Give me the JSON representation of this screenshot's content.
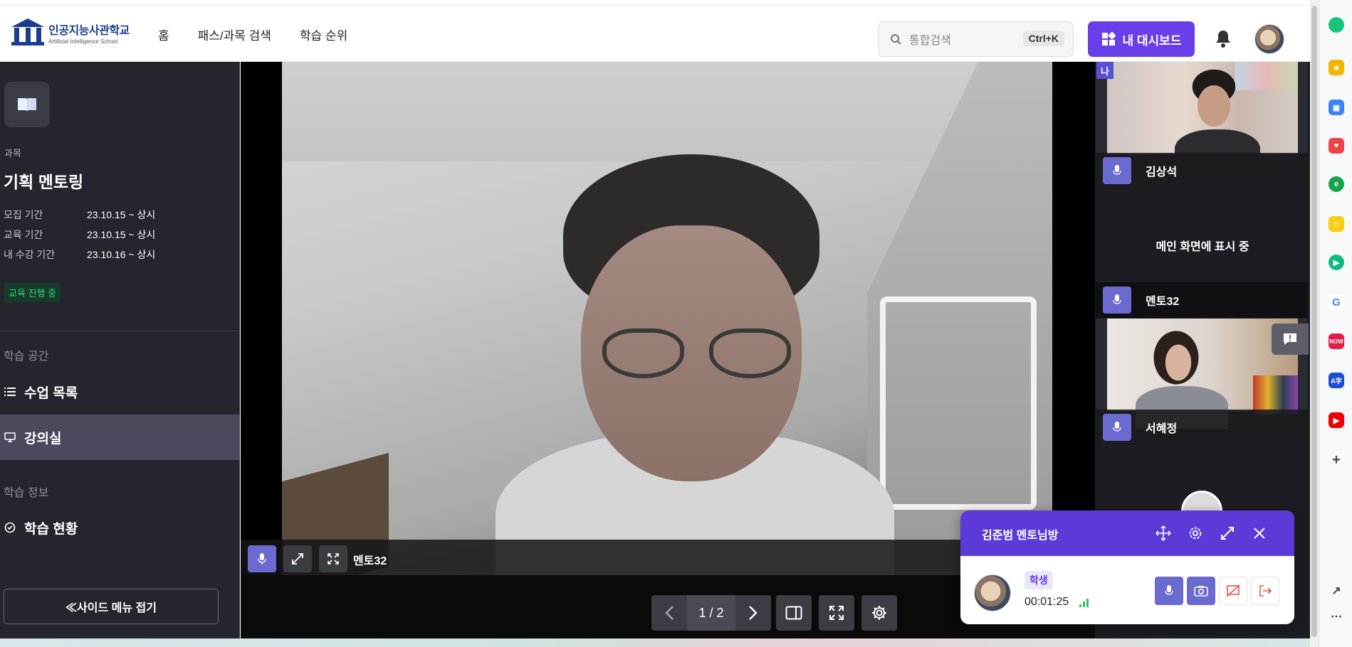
{
  "header": {
    "logo_ko": "인공지능사관학교",
    "logo_en": "Artificial Intelligence School",
    "nav": [
      "홈",
      "패스/과목 검색",
      "학습 순위"
    ],
    "search": {
      "placeholder": "통합검색",
      "shortcut": "Ctrl+K"
    },
    "dashboard_label": "내 대시보드"
  },
  "sidebar": {
    "category_label": "과목",
    "course_title": "기획 멘토링",
    "periods": [
      {
        "label": "모집 기간",
        "value": "23.10.15 ~ 상시"
      },
      {
        "label": "교육 기간",
        "value": "23.10.15 ~ 상시"
      },
      {
        "label": "내 수강 기간",
        "value": "23.10.16 ~ 상시"
      }
    ],
    "status": "교육 진행 중",
    "space_label": "학습 공간",
    "menu_class_list": "수업 목록",
    "menu_classroom": "강의실",
    "info_label": "학습 정보",
    "menu_progress": "학습 현황",
    "collapse_label": "≪사이드 메뉴 접기"
  },
  "stage": {
    "speaker_name": "멘토32",
    "pager": "1 / 2"
  },
  "participants": {
    "me_tag": "나",
    "p1_name": "김상석",
    "main_note": "메인 화면에 표시 중",
    "p2_name": "멘토32",
    "p3_name": "서혜정"
  },
  "room": {
    "title": "김준범 멘토님방",
    "role": "학생",
    "elapsed": "00:01:25"
  },
  "colors": {
    "accent": "#6a3ee8",
    "room_header": "#5b3ad8",
    "sidebar_bg": "#25252e",
    "mic_button": "#6b6ad0",
    "status_green": "#2ed37a"
  },
  "icons": [
    "search-icon",
    "dashboard-icon",
    "bell-icon",
    "book-icon",
    "list-icon",
    "monitor-icon",
    "check-circle-icon",
    "mic-icon",
    "expand-icon",
    "fullscreen-icon",
    "chevron-left-icon",
    "chevron-right-icon",
    "split-view-icon",
    "gear-icon",
    "move-icon",
    "close-icon",
    "camera-icon",
    "share-off-icon",
    "exit-icon",
    "signal-icon",
    "chat-icon"
  ]
}
